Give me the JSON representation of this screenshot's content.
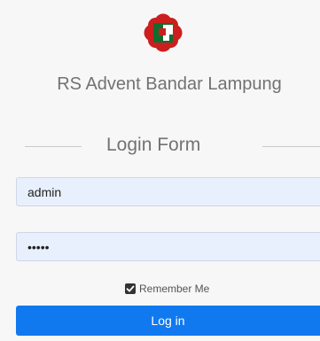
{
  "brand": {
    "hospital_name": "RS Advent Bandar Lampung"
  },
  "form": {
    "title": "Login Form",
    "username_value": "admin",
    "password_value": "admin",
    "remember_label": "Remember Me",
    "remember_checked": true,
    "submit_label": "Log in"
  },
  "colors": {
    "accent": "#1179ef",
    "logo_red": "#cc1e1e",
    "logo_green": "#0f6e2e",
    "field_background": "#e8f0fe"
  },
  "icons": {
    "logo": "hospital-logo",
    "remember_check": "checkmark-icon"
  }
}
